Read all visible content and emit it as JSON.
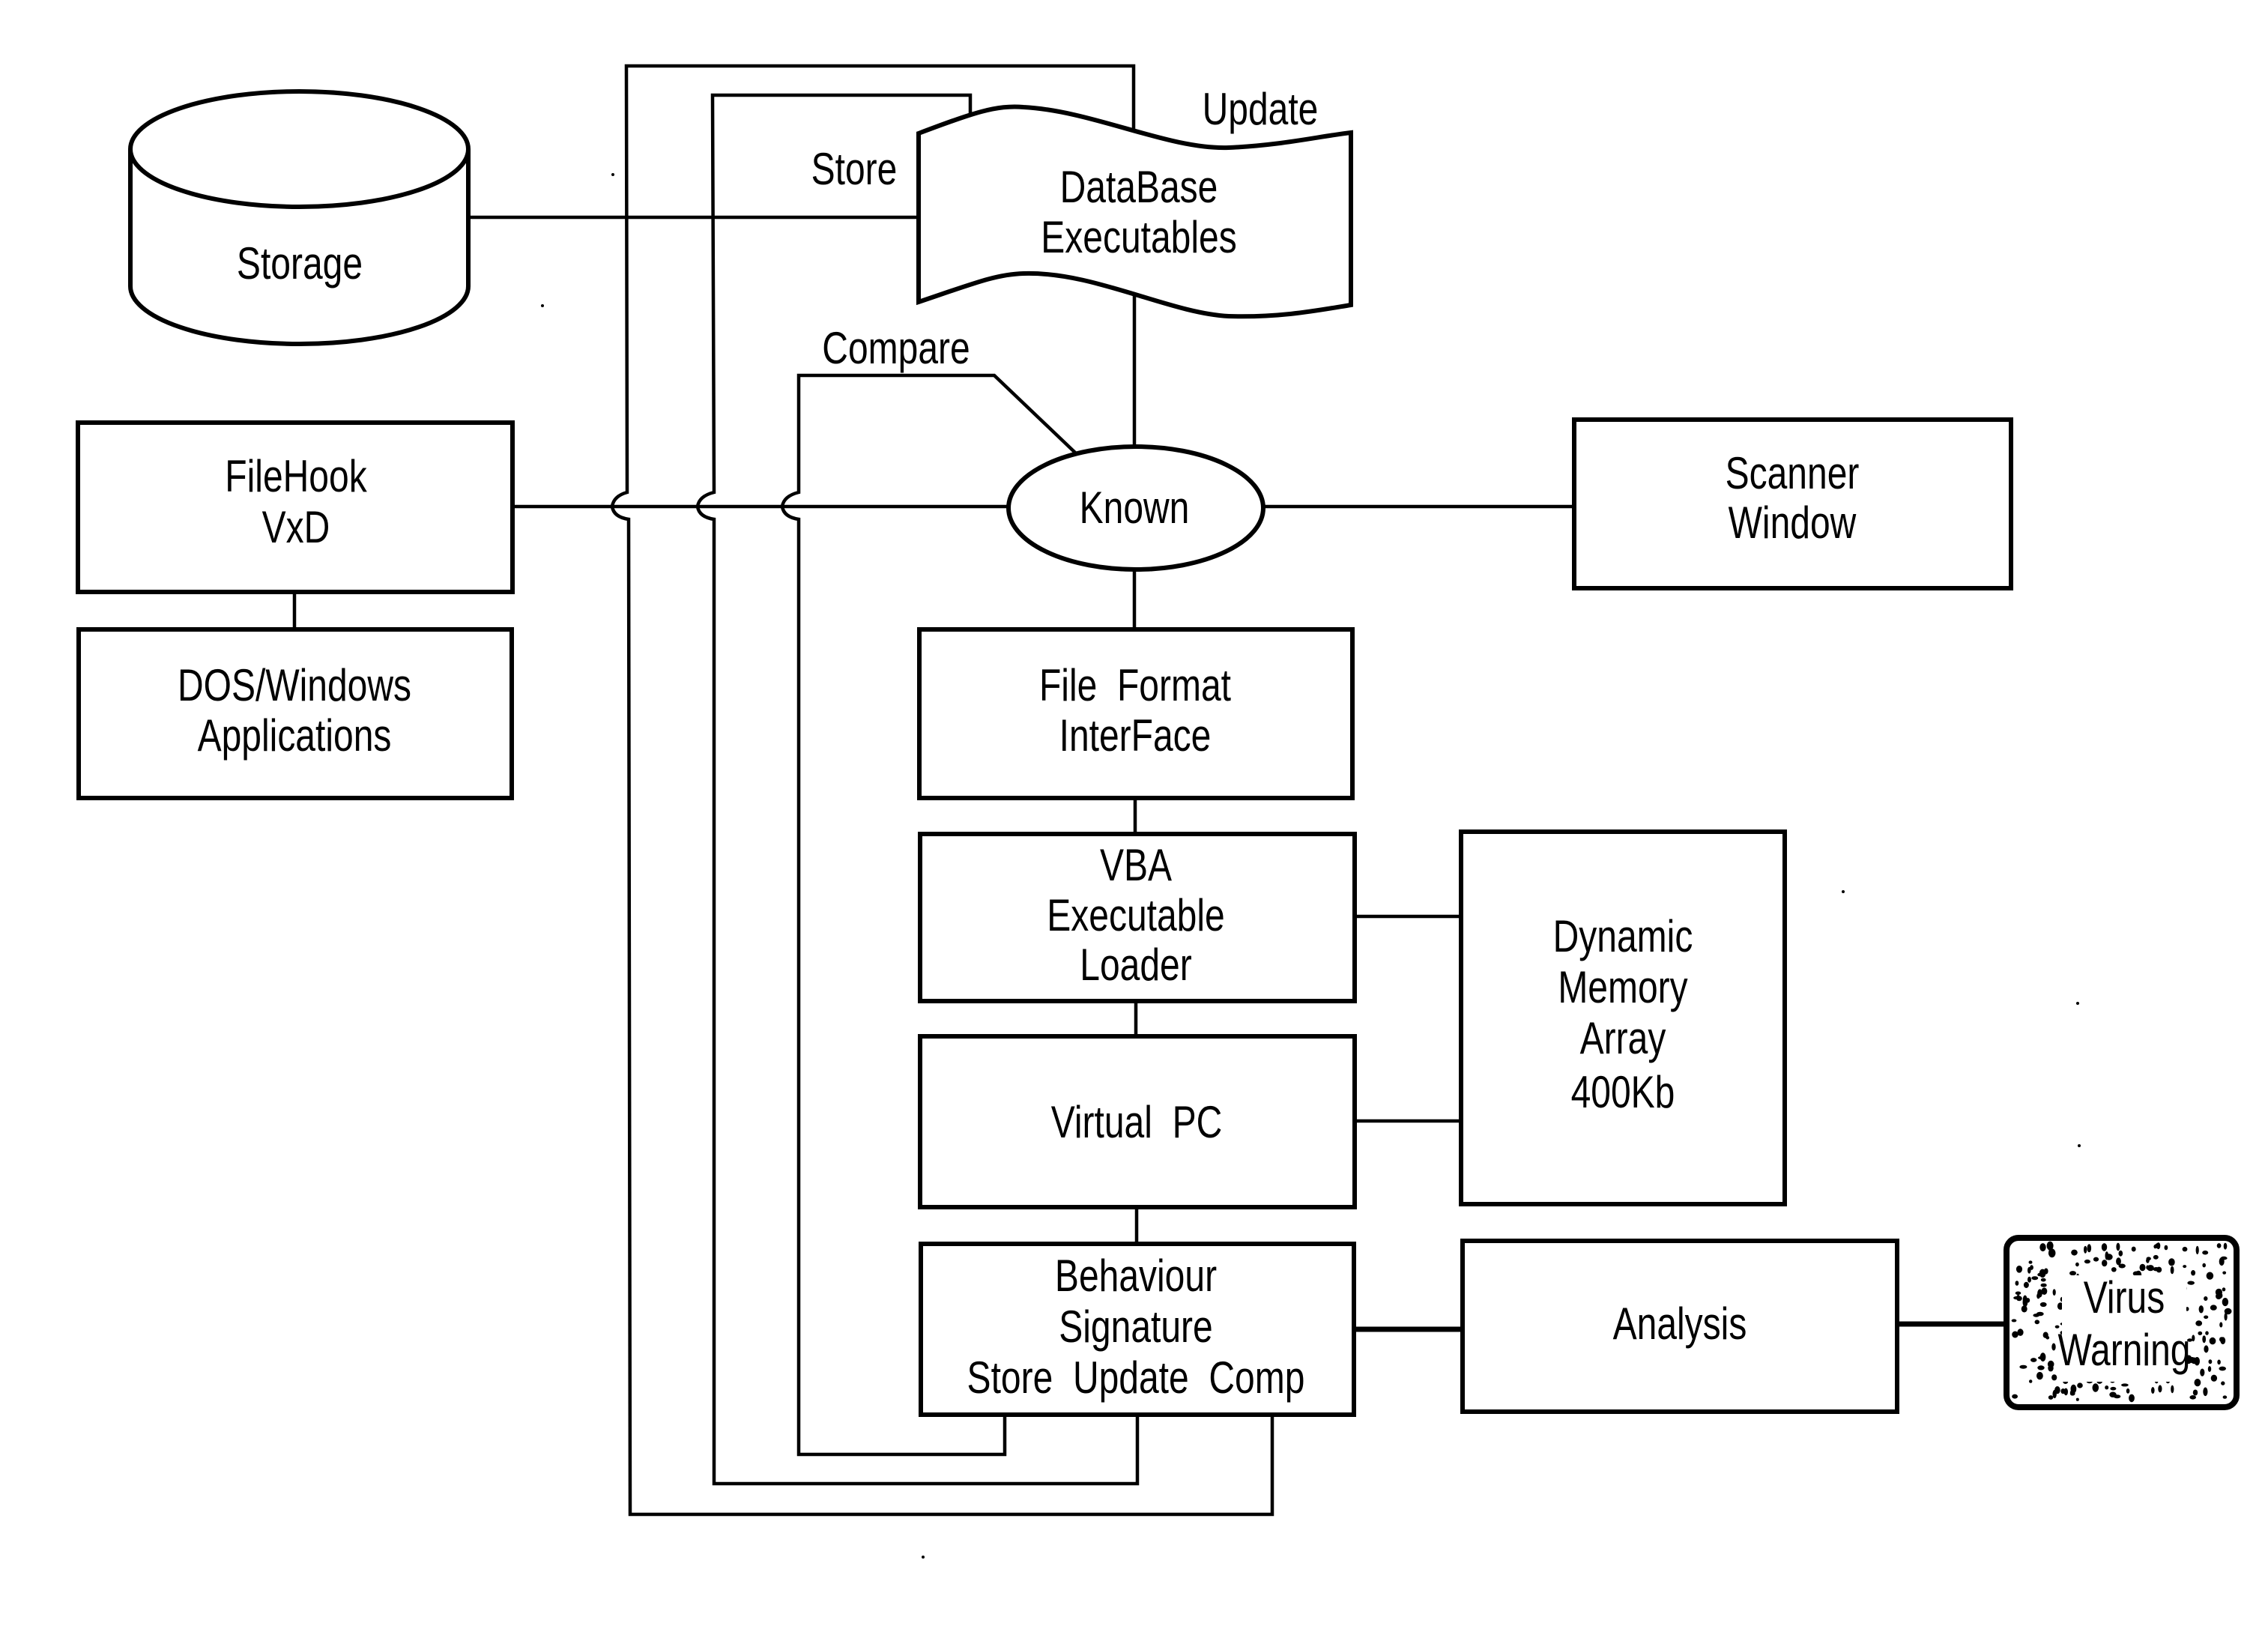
{
  "figure": {
    "type": "block-diagram",
    "subject": "Behaviour-based virus detection architecture"
  },
  "nodes": {
    "storage": {
      "label": [
        "Storage"
      ],
      "shape": "cylinder"
    },
    "database": {
      "label": [
        "DataBase",
        "Executables"
      ],
      "shape": "document-wave"
    },
    "filehook": {
      "label": [
        "FileHook",
        "VxD"
      ],
      "shape": "box"
    },
    "dos_windows": {
      "label": [
        "DOS/Windows",
        "Applications"
      ],
      "shape": "box"
    },
    "known": {
      "label": [
        "Known"
      ],
      "shape": "ellipse"
    },
    "scanner": {
      "label": [
        "Scanner",
        "Window"
      ],
      "shape": "box"
    },
    "file_format": {
      "label": [
        "File  Format",
        "InterFace"
      ],
      "shape": "box"
    },
    "vba_loader": {
      "label": [
        "VBA",
        "Executable",
        "Loader"
      ],
      "shape": "box"
    },
    "virtual_pc": {
      "label": [
        "Virtual  PC"
      ],
      "shape": "box"
    },
    "dynamic_memory": {
      "label": [
        "Dynamic",
        "Memory",
        "Array",
        "400Kb"
      ],
      "shape": "box"
    },
    "behaviour": {
      "label": [
        "Behaviour",
        "Signature",
        "Store  Update  Comp"
      ],
      "shape": "box"
    },
    "analysis": {
      "label": [
        "Analysis"
      ],
      "shape": "box"
    },
    "virus_warning": {
      "label": [
        "Virus",
        "Warning"
      ],
      "shape": "stippled-rounded-box"
    }
  },
  "edge_labels": {
    "store": "Store",
    "update": "Update",
    "compare": "Compare"
  },
  "edges": [
    {
      "from": "storage",
      "to": "database"
    },
    {
      "from": "filehook",
      "to": "dos_windows"
    },
    {
      "from": "filehook",
      "to": "known"
    },
    {
      "from": "database",
      "to": "known"
    },
    {
      "from": "known",
      "to": "scanner"
    },
    {
      "from": "known",
      "to": "file_format"
    },
    {
      "from": "file_format",
      "to": "vba_loader"
    },
    {
      "from": "vba_loader",
      "to": "virtual_pc"
    },
    {
      "from": "vba_loader",
      "to": "dynamic_memory"
    },
    {
      "from": "virtual_pc",
      "to": "dynamic_memory"
    },
    {
      "from": "virtual_pc",
      "to": "behaviour"
    },
    {
      "from": "behaviour",
      "to": "analysis"
    },
    {
      "from": "analysis",
      "to": "virus_warning"
    },
    {
      "from": "behaviour",
      "to": "database",
      "label": "Store"
    },
    {
      "from": "behaviour",
      "to": "database",
      "label": "Update"
    },
    {
      "from": "behaviour",
      "to": "known",
      "label": "Compare"
    }
  ]
}
